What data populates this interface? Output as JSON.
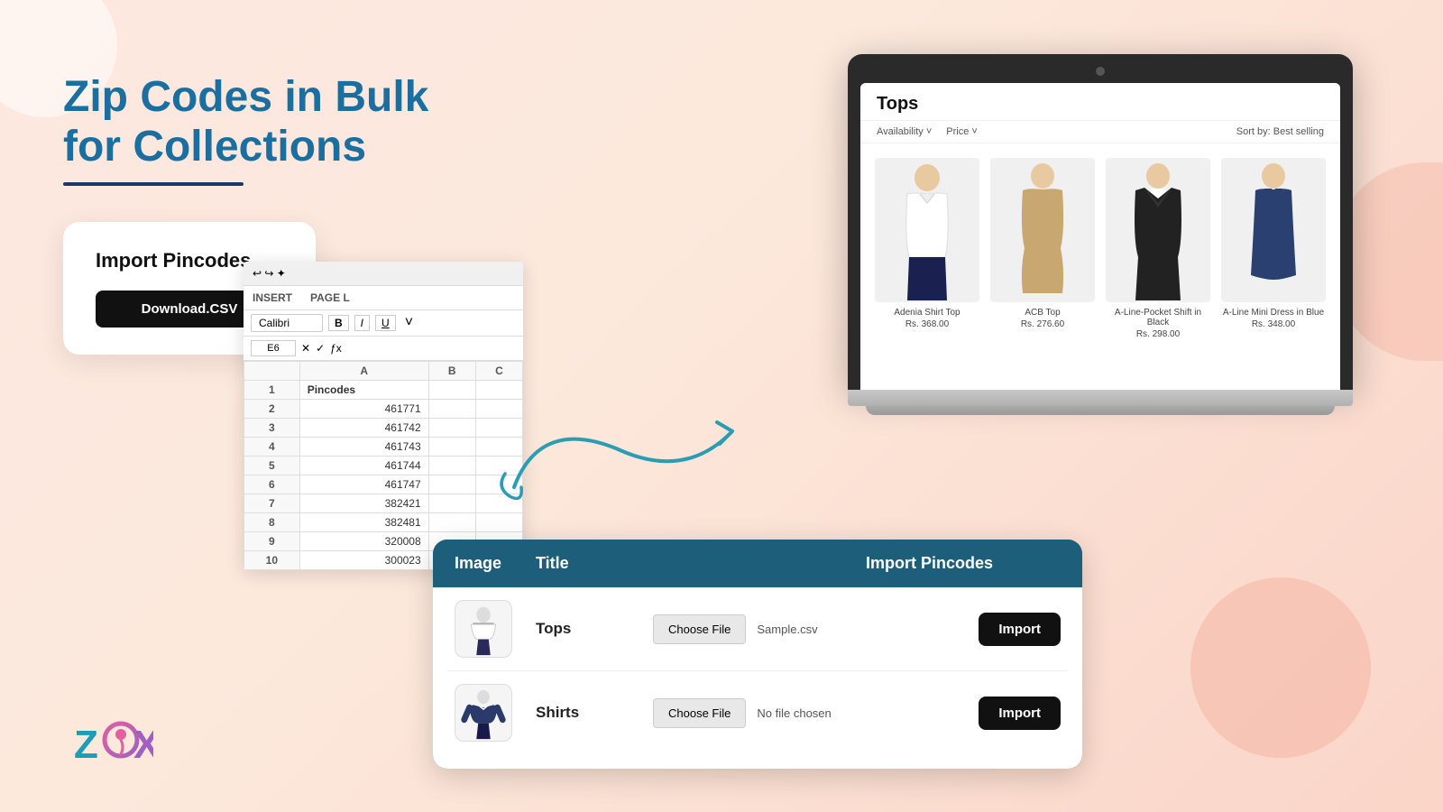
{
  "page": {
    "title": "Zip Codes in Bulk for Collections"
  },
  "heading": {
    "line1": "Zip Codes in Bulk",
    "line2": "for Collections"
  },
  "import_card": {
    "title": "Import Pincodes",
    "download_btn": "Download.CSV"
  },
  "excel": {
    "cell_ref": "E6",
    "ribbon_items": [
      "INSERT",
      "PAGE L"
    ],
    "font_name": "Calibri",
    "format_options": [
      "B",
      "I",
      "U"
    ],
    "columns": [
      "A",
      "B",
      "C"
    ],
    "header": "Pincodes",
    "rows": [
      {
        "row": "2",
        "val": "461771"
      },
      {
        "row": "3",
        "val": "461742"
      },
      {
        "row": "4",
        "val": "461743"
      },
      {
        "row": "5",
        "val": "461744"
      },
      {
        "row": "6",
        "val": "461747"
      },
      {
        "row": "7",
        "val": "382421"
      },
      {
        "row": "8",
        "val": "382481"
      },
      {
        "row": "9",
        "val": "320008"
      },
      {
        "row": "10",
        "val": "300023"
      }
    ]
  },
  "shop": {
    "title": "Tops",
    "filters": {
      "left": [
        "Availability",
        "Price"
      ],
      "right": "Best selling"
    },
    "products": [
      {
        "name": "Adenia Shirt Top",
        "price": "Rs. 368.00"
      },
      {
        "name": "ACB Top",
        "price": "Rs. 276.60"
      },
      {
        "name": "A-Line-Pocket Shift in Black",
        "price": "Rs. 298.00"
      },
      {
        "name": "A-Line Mini Dress in Blue",
        "price": "Rs. 348.00"
      }
    ]
  },
  "bottom_table": {
    "headers": [
      "Image",
      "Title",
      "Import Pincodes"
    ],
    "rows": [
      {
        "title": "Tops",
        "choose_file_label": "Choose File",
        "file_name": "Sample.csv",
        "import_label": "Import"
      },
      {
        "title": "Shirts",
        "choose_file_label": "Choose File",
        "file_name": "No file chosen",
        "import_label": "Import"
      }
    ]
  },
  "logo": {
    "text": "ZOX"
  }
}
